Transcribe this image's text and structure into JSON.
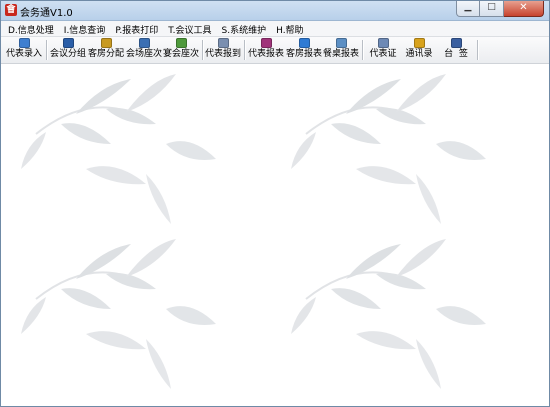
{
  "window": {
    "title": "会务通V1.0",
    "app_icon_glyph": "會"
  },
  "menus": [
    "D.信息处理",
    "I.信息查询",
    "P.报表打印",
    "T.会议工具",
    "S.系统维护",
    "H.帮助"
  ],
  "toolbar": {
    "buttons": [
      {
        "label": "代表录入",
        "icon": "document-add-icon",
        "color": "#3f7fd0"
      },
      {
        "label": "会议分组",
        "icon": "calendar-grid-icon",
        "color": "#2a5ea8"
      },
      {
        "label": "客房分配",
        "icon": "door-icon",
        "color": "#c89a22"
      },
      {
        "label": "会场座次",
        "icon": "seat-chart-icon",
        "color": "#3b6fb3"
      },
      {
        "label": "宴会座次",
        "icon": "banquet-table-icon",
        "color": "#4f9a3c"
      },
      {
        "label": "代表报到",
        "icon": "register-doc-icon",
        "color": "#7a8fb0"
      },
      {
        "label": "代表报表",
        "icon": "report-people-icon",
        "color": "#a0347a"
      },
      {
        "label": "客房报表",
        "icon": "refresh-report-icon",
        "color": "#2f7bd4"
      },
      {
        "label": "餐桌报表",
        "icon": "table-report-icon",
        "color": "#5c8fc4"
      },
      {
        "label": "代表证",
        "icon": "badge-card-icon",
        "color": "#6d89b5"
      },
      {
        "label": "通讯录",
        "icon": "address-book-icon",
        "color": "#d8a21c"
      },
      {
        "label": "台  签",
        "icon": "name-plate-icon",
        "color": "#3a5fa0"
      }
    ]
  },
  "background": {
    "pattern": "bamboo-leaf-watermark",
    "leaf_color": "#d9dcdf"
  }
}
